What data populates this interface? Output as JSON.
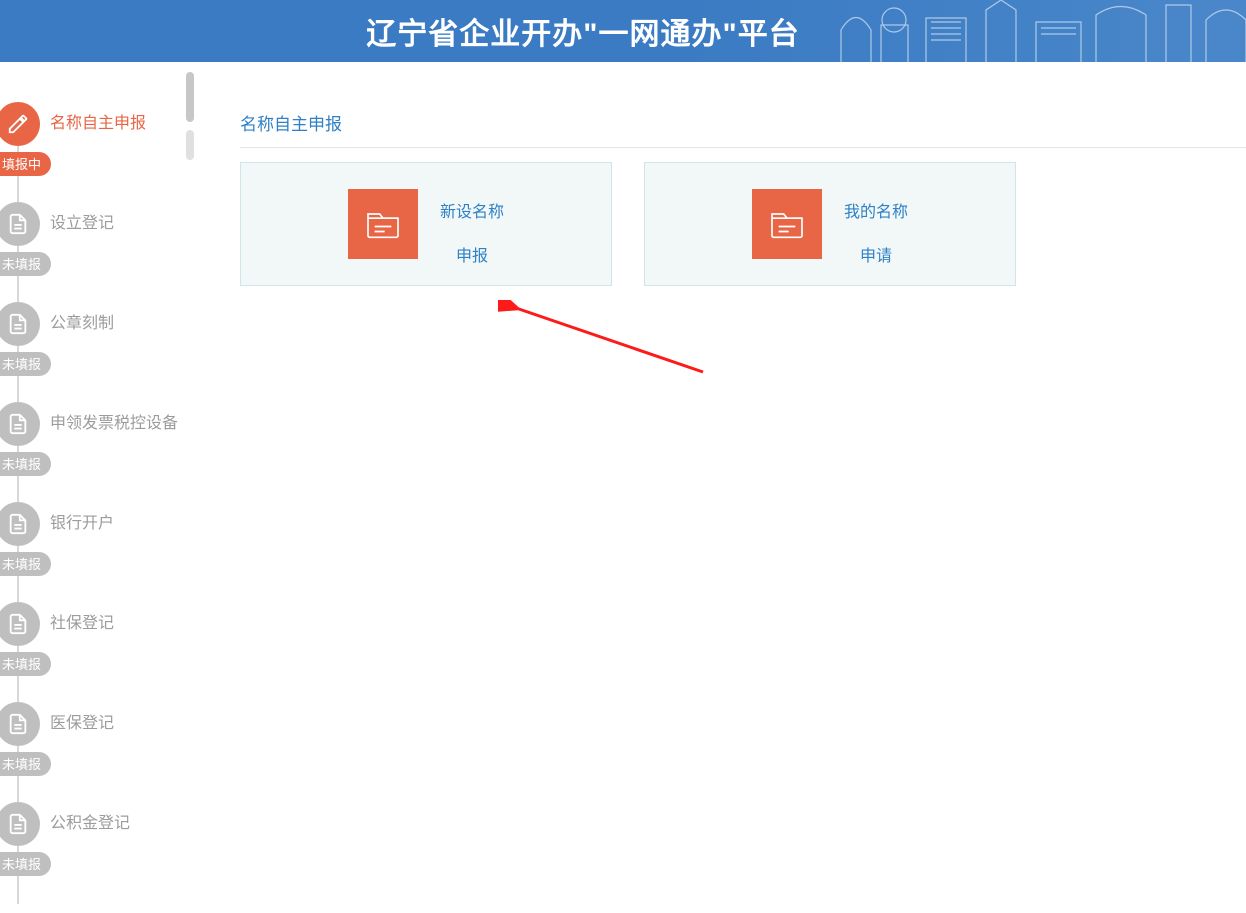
{
  "header": {
    "title": "辽宁省企业开办\"一网通办\"平台"
  },
  "sidebar": {
    "steps": [
      {
        "label": "名称自主申报",
        "status": "填报中",
        "active": true
      },
      {
        "label": "设立登记",
        "status": "未填报",
        "active": false
      },
      {
        "label": "公章刻制",
        "status": "未填报",
        "active": false
      },
      {
        "label": "申领发票税控设备",
        "status": "未填报",
        "active": false
      },
      {
        "label": "银行开户",
        "status": "未填报",
        "active": false
      },
      {
        "label": "社保登记",
        "status": "未填报",
        "active": false
      },
      {
        "label": "医保登记",
        "status": "未填报",
        "active": false
      },
      {
        "label": "公积金登记",
        "status": "未填报",
        "active": false
      }
    ]
  },
  "main": {
    "section_title": "名称自主申报",
    "cards": [
      {
        "line1": "新设名称",
        "line2": "申报"
      },
      {
        "line1": "我的名称",
        "line2": "申请"
      }
    ]
  },
  "colors": {
    "accent": "#e86645",
    "primary": "#2f80c6"
  }
}
